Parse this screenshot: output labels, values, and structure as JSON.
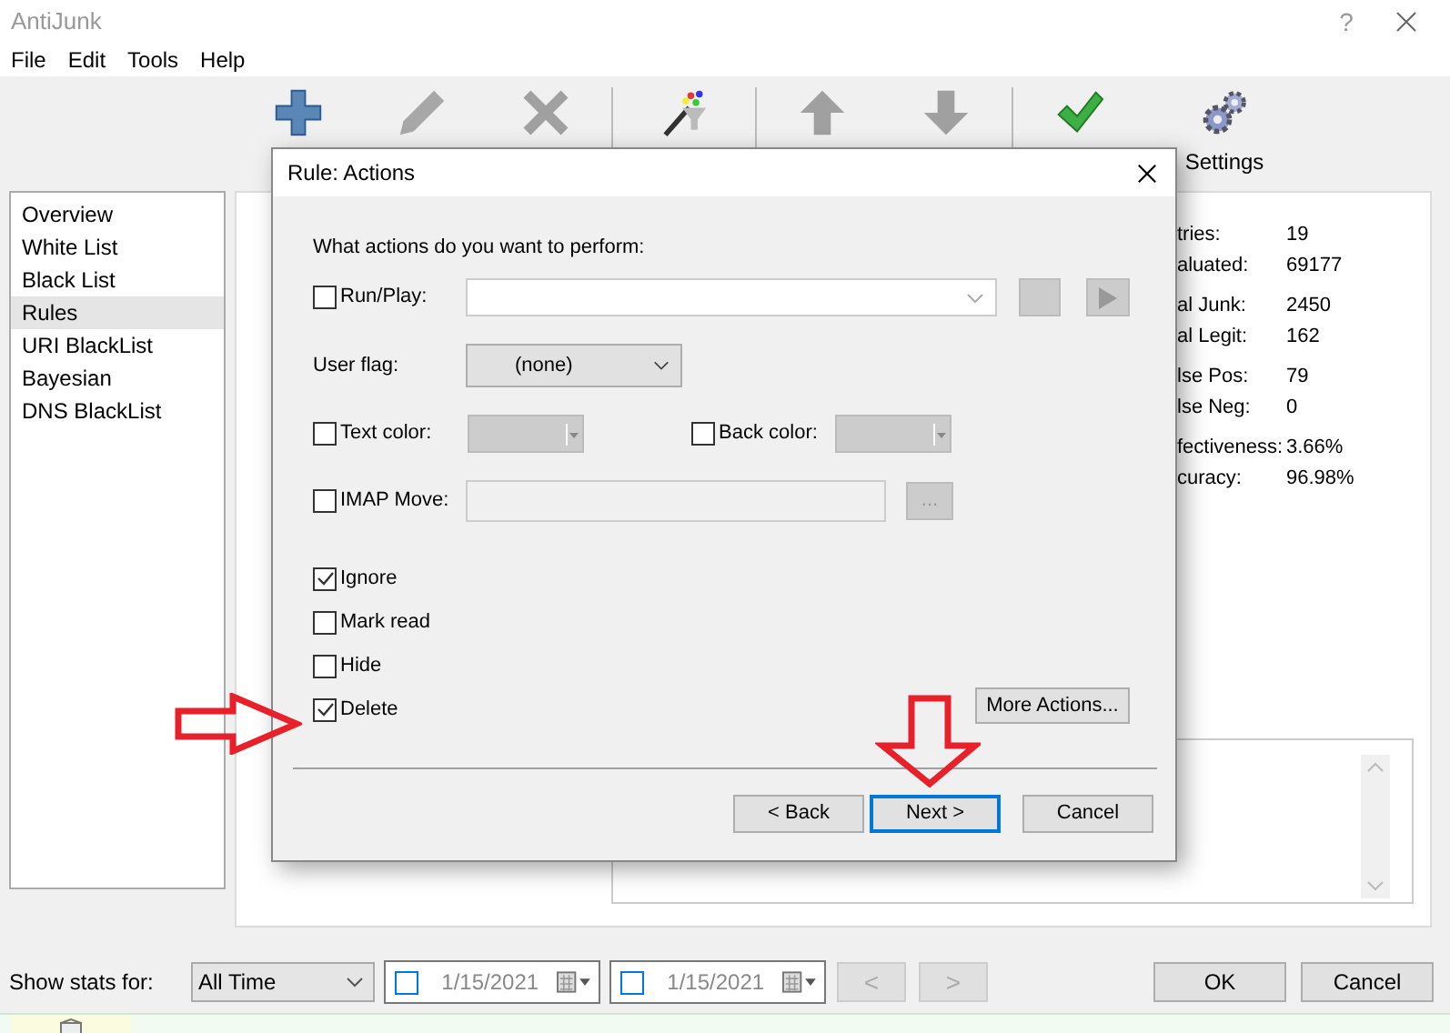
{
  "window": {
    "title": "AntiJunk",
    "help": "?"
  },
  "menu": [
    "File",
    "Edit",
    "Tools",
    "Help"
  ],
  "toolbar": [
    {
      "kind": "add",
      "disabled": false
    },
    {
      "kind": "edit",
      "disabled": true
    },
    {
      "kind": "delete",
      "disabled": true
    },
    {
      "kind": "wizard",
      "disabled": false
    },
    {
      "kind": "up",
      "disabled": true
    },
    {
      "kind": "down",
      "disabled": true
    },
    {
      "kind": "test",
      "disabled": false
    },
    {
      "kind": "settings",
      "label": "Settings",
      "disabled": false
    }
  ],
  "sidebar": {
    "items": [
      {
        "label": "Overview",
        "selected": false
      },
      {
        "label": "White List",
        "selected": false
      },
      {
        "label": "Black List",
        "selected": false
      },
      {
        "label": "Rules",
        "selected": true
      },
      {
        "label": "URI BlackList",
        "selected": false
      },
      {
        "label": "Bayesian",
        "selected": false
      },
      {
        "label": "DNS BlackList",
        "selected": false
      }
    ]
  },
  "stats": [
    [
      {
        "label": "tries:",
        "value": "19"
      },
      {
        "label": "aluated:",
        "value": "69177"
      }
    ],
    [
      {
        "label": "al Junk:",
        "value": "2450"
      },
      {
        "label": "al Legit:",
        "value": "162"
      }
    ],
    [
      {
        "label": "lse Pos:",
        "value": "79"
      },
      {
        "label": "lse Neg:",
        "value": "0"
      }
    ],
    [
      {
        "label": "fectiveness:",
        "value": "3.66%"
      },
      {
        "label": "curacy:",
        "value": "96.98%"
      }
    ]
  ],
  "dialog": {
    "title": "Rule: Actions",
    "prompt": "What actions do you want to perform:",
    "run_play": {
      "label": "Run/Play:",
      "checked": false
    },
    "user_flag": {
      "label": "User flag:",
      "value": "(none)"
    },
    "text_color": {
      "label": "Text color:",
      "checked": false
    },
    "back_color": {
      "label": "Back color:",
      "checked": false
    },
    "imap_move": {
      "label": "IMAP Move:",
      "checked": false,
      "browse": "..."
    },
    "options": [
      {
        "label": "Ignore",
        "checked": true
      },
      {
        "label": "Mark read",
        "checked": false
      },
      {
        "label": "Hide",
        "checked": false
      },
      {
        "label": "Delete",
        "checked": true
      }
    ],
    "more_actions": "More Actions...",
    "buttons": [
      {
        "label": "< Back",
        "focused": false
      },
      {
        "label": "Next >",
        "focused": true
      },
      {
        "label": "Cancel",
        "focused": false
      }
    ]
  },
  "bottom": {
    "show_stats_label": "Show stats for:",
    "period": "All Time",
    "date_from": {
      "value": "1/15/2021",
      "checked": false
    },
    "date_to": {
      "value": "1/15/2021",
      "checked": false
    },
    "prev": "<",
    "next": ">",
    "ok": "OK",
    "cancel": "Cancel"
  }
}
